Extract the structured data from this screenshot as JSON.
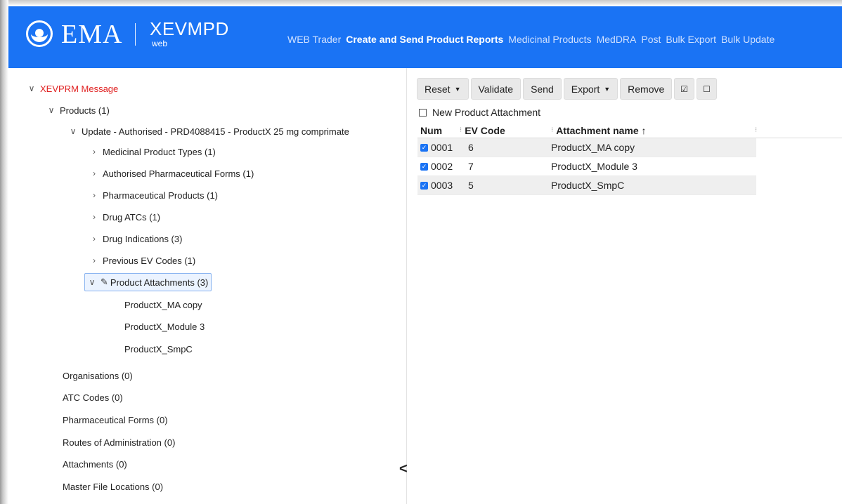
{
  "header": {
    "logo_text": "EMA",
    "app_name": "XEVMPD",
    "app_sub": "web",
    "nav": [
      {
        "label": "WEB Trader",
        "active": false
      },
      {
        "label": "Create and Send Product Reports",
        "active": true
      },
      {
        "label": "Medicinal Products",
        "active": false
      },
      {
        "label": "MedDRA",
        "active": false
      },
      {
        "label": "Post",
        "active": false
      },
      {
        "label": "Bulk Export",
        "active": false
      },
      {
        "label": "Bulk Update",
        "active": false
      }
    ]
  },
  "tree": {
    "root": "XEVPRM Message",
    "products": "Products (1)",
    "product_update": "Update - Authorised - PRD4088415 - ProductX 25 mg comprimate",
    "children": [
      "Medicinal Product Types (1)",
      "Authorised Pharmaceutical Forms (1)",
      "Pharmaceutical Products (1)",
      "Drug ATCs (1)",
      "Drug Indications (3)",
      "Previous EV Codes (1)"
    ],
    "attachments_node": "Product Attachments (3)",
    "attachment_items": [
      "ProductX_MA copy",
      "ProductX_Module 3",
      "ProductX_SmpC"
    ],
    "other_nodes": [
      "Organisations (0)",
      "ATC Codes (0)",
      "Pharmaceutical Forms (0)",
      "Routes of Administration (0)",
      "Attachments (0)",
      "Master File Locations (0)"
    ],
    "collapse_icon": "<"
  },
  "toolbar": {
    "reset": "Reset",
    "validate": "Validate",
    "send": "Send",
    "export": "Export",
    "remove": "Remove",
    "check_all": "☑",
    "uncheck_all": "☐"
  },
  "new_attachment_label": "New Product Attachment",
  "grid": {
    "columns": [
      "Num",
      "EV Code",
      "Attachment name ↑"
    ],
    "rows": [
      {
        "num": "0001",
        "ev_code": "6",
        "name": "ProductX_MA copy",
        "checked": true
      },
      {
        "num": "0002",
        "ev_code": "7",
        "name": "ProductX_Module 3",
        "checked": true
      },
      {
        "num": "0003",
        "ev_code": "5",
        "name": "ProductX_SmpC",
        "checked": true
      }
    ]
  }
}
